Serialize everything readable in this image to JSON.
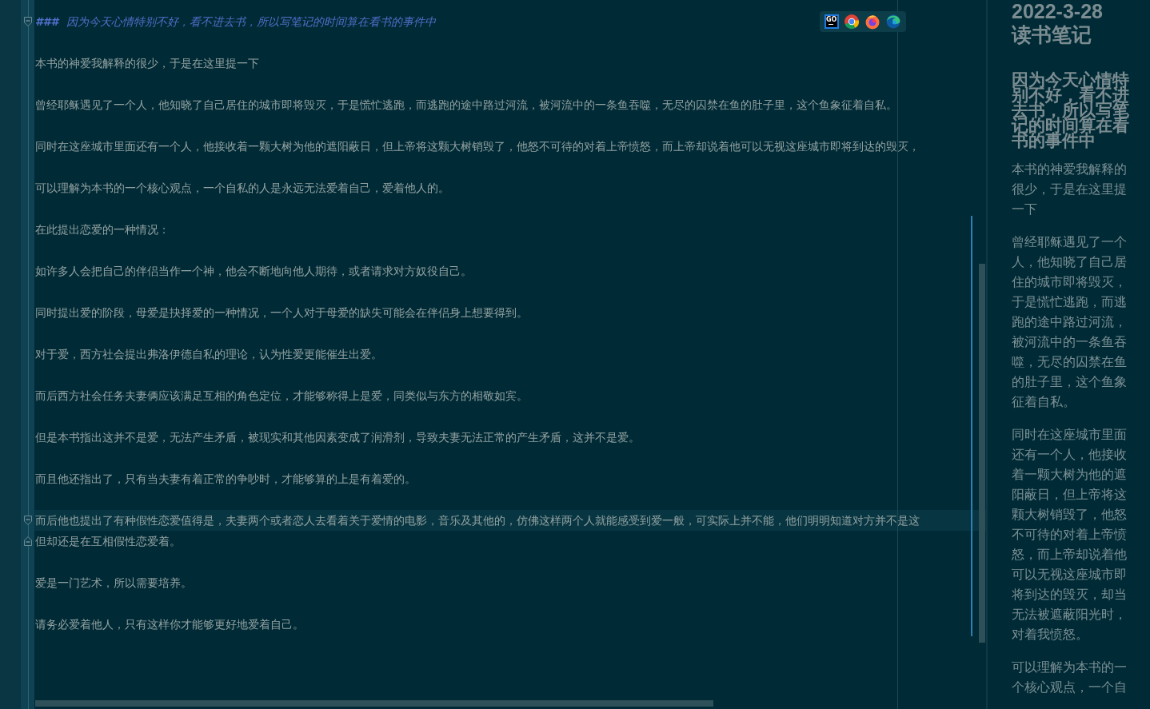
{
  "editor": {
    "blocks": [
      {
        "lines": [
          {
            "kind": "heading",
            "marker": "###",
            "text": "因为今天心情特别不好，看不进去书，所以写笔记的时间算在看书的事件中",
            "current": false,
            "fold_start": true,
            "fold_end": false
          }
        ]
      },
      {
        "lines": [
          {
            "kind": "text",
            "text": "本书的神爱我解释的很少，于是在这里提一下",
            "current": false,
            "fold_start": false,
            "fold_end": false
          }
        ]
      },
      {
        "lines": [
          {
            "kind": "text",
            "text": "曾经耶稣遇见了一个人，他知晓了自己居住的城市即将毁灭，于是慌忙逃跑，而逃跑的途中路过河流，被河流中的一条鱼吞噬，无尽的囚禁在鱼的肚子里，这个鱼象征着自私。",
            "current": false,
            "fold_start": false,
            "fold_end": false
          }
        ]
      },
      {
        "lines": [
          {
            "kind": "text",
            "text": "同时在这座城市里面还有一个人，他接收着一颗大树为他的遮阳蔽日，但上帝将这颗大树销毁了，他怒不可待的对着上帝愤怒，而上帝却说着他可以无视这座城市即将到达的毁灭，",
            "current": false,
            "fold_start": false,
            "fold_end": false
          }
        ]
      },
      {
        "lines": [
          {
            "kind": "text",
            "text": "可以理解为本书的一个核心观点，一个自私的人是永远无法爱着自己，爱着他人的。",
            "current": false,
            "fold_start": false,
            "fold_end": false
          }
        ]
      },
      {
        "lines": [
          {
            "kind": "text",
            "text": "在此提出恋爱的一种情况：",
            "current": false,
            "fold_start": false,
            "fold_end": false
          }
        ]
      },
      {
        "lines": [
          {
            "kind": "text",
            "text": "如许多人会把自己的伴侣当作一个神，他会不断地向他人期待，或者请求对方奴役自己。",
            "current": false,
            "fold_start": false,
            "fold_end": false
          }
        ]
      },
      {
        "lines": [
          {
            "kind": "text",
            "text": "同时提出爱的阶段，母爱是抉择爱的一种情况，一个人对于母爱的缺失可能会在伴侣身上想要得到。",
            "current": false,
            "fold_start": false,
            "fold_end": false
          }
        ]
      },
      {
        "lines": [
          {
            "kind": "text",
            "text": "对于爱，西方社会提出弗洛伊德自私的理论，认为性爱更能催生出爱。",
            "current": false,
            "fold_start": false,
            "fold_end": false
          }
        ]
      },
      {
        "lines": [
          {
            "kind": "text",
            "text": "而后西方社会任务夫妻俩应该满足互相的角色定位，才能够称得上是爱，同类似与东方的相敬如宾。",
            "current": false,
            "fold_start": false,
            "fold_end": false
          }
        ]
      },
      {
        "lines": [
          {
            "kind": "text",
            "text": "但是本书指出这并不是爱，无法产生矛盾，被现实和其他因素变成了润滑剂，导致夫妻无法正常的产生矛盾，这并不是爱。",
            "current": false,
            "fold_start": false,
            "fold_end": false
          }
        ]
      },
      {
        "lines": [
          {
            "kind": "text",
            "text": "而且他还指出了，只有当夫妻有着正常的争吵时，才能够算的上是有着爱的。",
            "current": false,
            "fold_start": false,
            "fold_end": false
          }
        ]
      },
      {
        "lines": [
          {
            "kind": "text",
            "text": "而后他也提出了有种假性恋爱值得是，夫妻两个或者恋人去看着关于爱情的电影，音乐及其他的，仿佛这样两个人就能感受到爱一般，可实际上并不能，他们明明知道对方并不是这",
            "current": true,
            "fold_start": true,
            "fold_end": false
          },
          {
            "kind": "text",
            "text": "但却还是在互相假性恋爱着。",
            "current": false,
            "fold_start": false,
            "fold_end": true
          }
        ]
      },
      {
        "lines": [
          {
            "kind": "text",
            "text": "爱是一门艺术，所以需要培养。",
            "current": false,
            "fold_start": false,
            "fold_end": false
          }
        ]
      },
      {
        "lines": [
          {
            "kind": "text",
            "text": "请务必爱着他人，只有这样你才能够更好地爱着自己。",
            "current": false,
            "fold_start": false,
            "fold_end": false
          }
        ]
      }
    ]
  },
  "browser_bar": [
    {
      "kind": "goland",
      "label": "GO"
    },
    {
      "kind": "chrome"
    },
    {
      "kind": "firefox"
    },
    {
      "kind": "edge"
    }
  ],
  "preview": {
    "title": "2022-3-28 读书笔记",
    "heading": "因为今天心情特别不好，看不进去书，所以写笔记的时间算在看书的事件中",
    "paragraphs": [
      "本书的神爱我解释的很少，于是在这里提一下",
      "曾经耶稣遇见了一个人，他知晓了自己居住的城市即将毁灭，于是慌忙逃跑，而逃跑的途中路过河流，被河流中的一条鱼吞噬，无尽的囚禁在鱼的肚子里，这个鱼象征着自私。",
      "同时在这座城市里面还有一个人，他接收着一颗大树为他的遮阳蔽日，但上帝将这颗大树销毁了，他怒不可待的对着上帝愤怒，而上帝却说着他可以无视这座城市即将到达的毁灭，却当无法被遮蔽阳光时，对着我愤怒。",
      "可以理解为本书的一个核心观点，一个自"
    ]
  }
}
